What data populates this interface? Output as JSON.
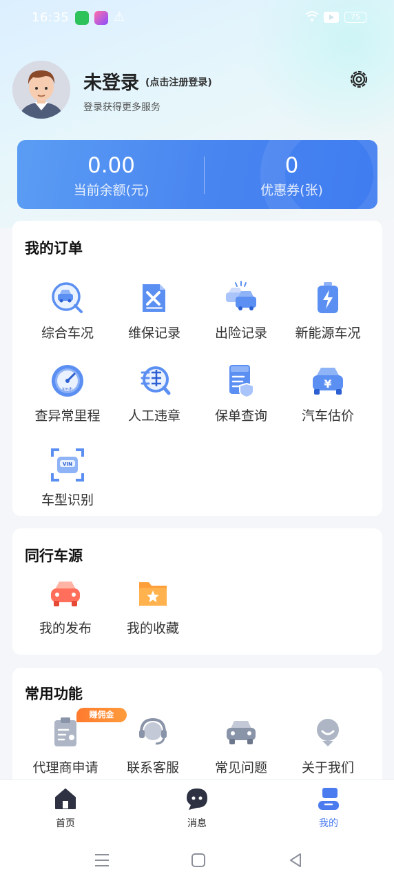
{
  "status_bar": {
    "time": "16:35",
    "battery": "75",
    "icons": [
      "app-green-icon",
      "app-purple-icon",
      "warning-icon",
      "wifi-icon",
      "video-icon",
      "battery-icon"
    ]
  },
  "profile": {
    "name": "未登录",
    "login_hint": "(点击注册登录)",
    "subtitle": "登录获得更多服务"
  },
  "balance": {
    "amount_value": "0.00",
    "amount_label": "当前余额(元)",
    "coupon_value": "0",
    "coupon_label": "优惠券(张)"
  },
  "orders": {
    "title": "我的订单",
    "items": [
      {
        "label": "综合车况",
        "icon": "car-search-icon"
      },
      {
        "label": "维保记录",
        "icon": "maintenance-icon"
      },
      {
        "label": "出险记录",
        "icon": "accident-icon"
      },
      {
        "label": "新能源车况",
        "icon": "battery-charge-icon"
      },
      {
        "label": "查异常里程",
        "icon": "speedometer-icon"
      },
      {
        "label": "人工违章",
        "icon": "violation-icon"
      },
      {
        "label": "保单查询",
        "icon": "policy-icon"
      },
      {
        "label": "汽车估价",
        "icon": "car-price-icon"
      },
      {
        "label": "车型识别",
        "icon": "vin-scan-icon"
      }
    ]
  },
  "peer_cars": {
    "title": "同行车源",
    "items": [
      {
        "label": "我的发布",
        "icon": "car-publish-icon"
      },
      {
        "label": "我的收藏",
        "icon": "favorite-folder-icon"
      }
    ]
  },
  "common": {
    "title": "常用功能",
    "badge": "赚佣金",
    "items": [
      {
        "label": "代理商申请",
        "icon": "agent-apply-icon"
      },
      {
        "label": "联系客服",
        "icon": "customer-service-icon"
      },
      {
        "label": "常见问题",
        "icon": "faq-car-icon"
      },
      {
        "label": "关于我们",
        "icon": "about-icon"
      }
    ]
  },
  "bottom_nav": {
    "items": [
      {
        "label": "首页",
        "icon": "home-icon"
      },
      {
        "label": "消息",
        "icon": "message-icon"
      },
      {
        "label": "我的",
        "icon": "profile-icon",
        "active": true
      }
    ]
  },
  "colors": {
    "accent": "#4a7cf0",
    "badge": "#ff8a35"
  }
}
